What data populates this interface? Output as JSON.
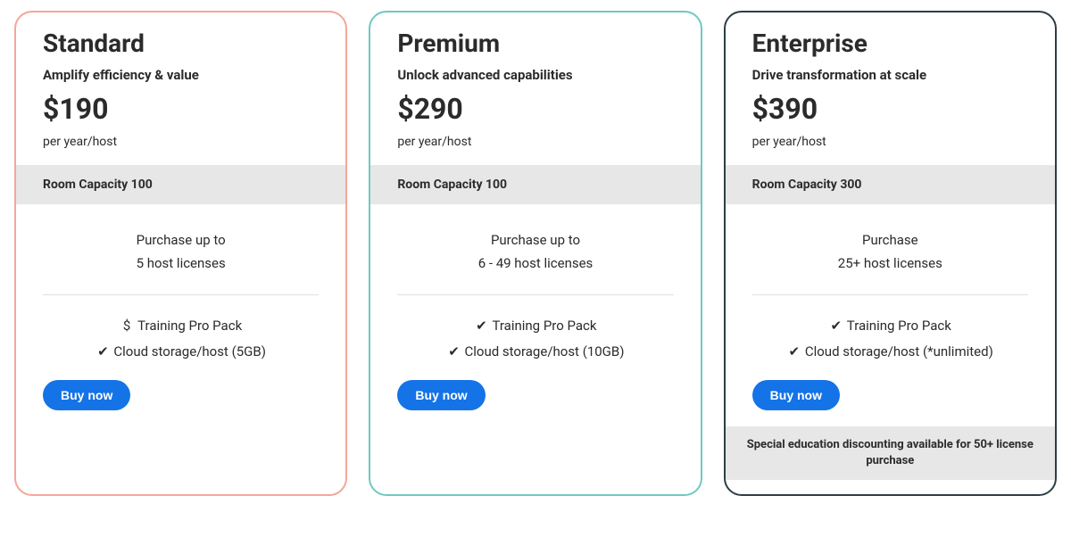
{
  "plans": [
    {
      "id": "standard",
      "title": "Standard",
      "tagline": "Amplify efficiency & value",
      "price": "$190",
      "unit": "per year/host",
      "capacity": "Room Capacity 100",
      "purchase_line1": "Purchase up to",
      "purchase_line2": "5 host licenses",
      "feature1_mark": "$",
      "feature1_label": "Training Pro Pack",
      "feature2_mark": "✔",
      "feature2_label": "Cloud storage/host (5GB)",
      "cta": "Buy now"
    },
    {
      "id": "premium",
      "title": "Premium",
      "tagline": "Unlock advanced capabilities",
      "price": "$290",
      "unit": "per year/host",
      "capacity": "Room Capacity 100",
      "purchase_line1": "Purchase up to",
      "purchase_line2": "6 - 49 host licenses",
      "feature1_mark": "✔",
      "feature1_label": "Training Pro Pack",
      "feature2_mark": "✔",
      "feature2_label": "Cloud storage/host (10GB)",
      "cta": "Buy now"
    },
    {
      "id": "enterprise",
      "title": "Enterprise",
      "tagline": "Drive transformation at scale",
      "price": "$390",
      "unit": "per year/host",
      "capacity": "Room Capacity 300",
      "purchase_line1": "Purchase",
      "purchase_line2": "25+ host licenses",
      "feature1_mark": "✔",
      "feature1_label": "Training Pro Pack",
      "feature2_mark": "✔",
      "feature2_label": "Cloud storage/host (*unlimited)",
      "cta": "Buy now",
      "special": "Special education discounting available for 50+ license purchase"
    }
  ]
}
